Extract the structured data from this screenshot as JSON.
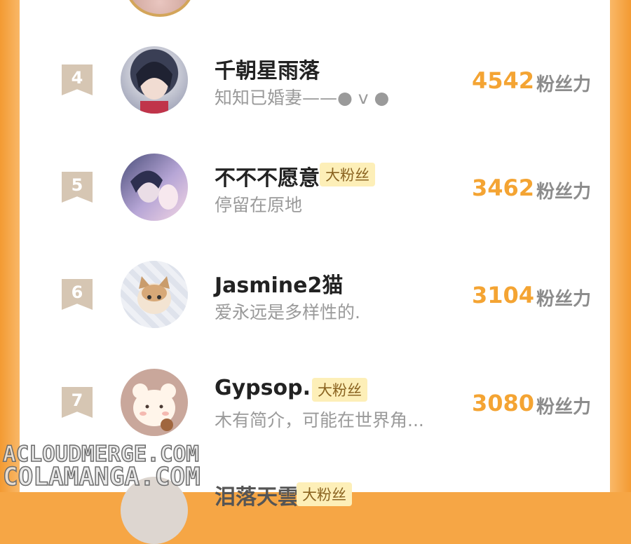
{
  "unit_label": "粉丝力",
  "rows": [
    {
      "rank": "4",
      "name": "千朝星雨落",
      "badge": "",
      "bio": "知知已婚妻——● v ●",
      "score": "4542"
    },
    {
      "rank": "5",
      "name": "不不不愿意",
      "badge": "大粉丝",
      "bio": "停留在原地",
      "score": "3462"
    },
    {
      "rank": "6",
      "name": "Jasmine2猫",
      "badge": "",
      "bio": "爱永远是多样性的.",
      "score": "3104"
    },
    {
      "rank": "7",
      "name": "Gypsop...",
      "badge": "大粉丝",
      "bio": "木有简介，可能在世界角...",
      "score": "3080"
    }
  ],
  "partial_row": {
    "name": "泪落天雲",
    "badge": "大粉丝"
  },
  "watermark": {
    "line1": "ACLOUDMERGE.COM",
    "line2": "COLAMANGA.COM"
  },
  "colors": {
    "accent": "#f4a433",
    "badge_bg": "#fdefb8",
    "rank_bg": "#d6c6b3",
    "frame": "#f6a645"
  }
}
